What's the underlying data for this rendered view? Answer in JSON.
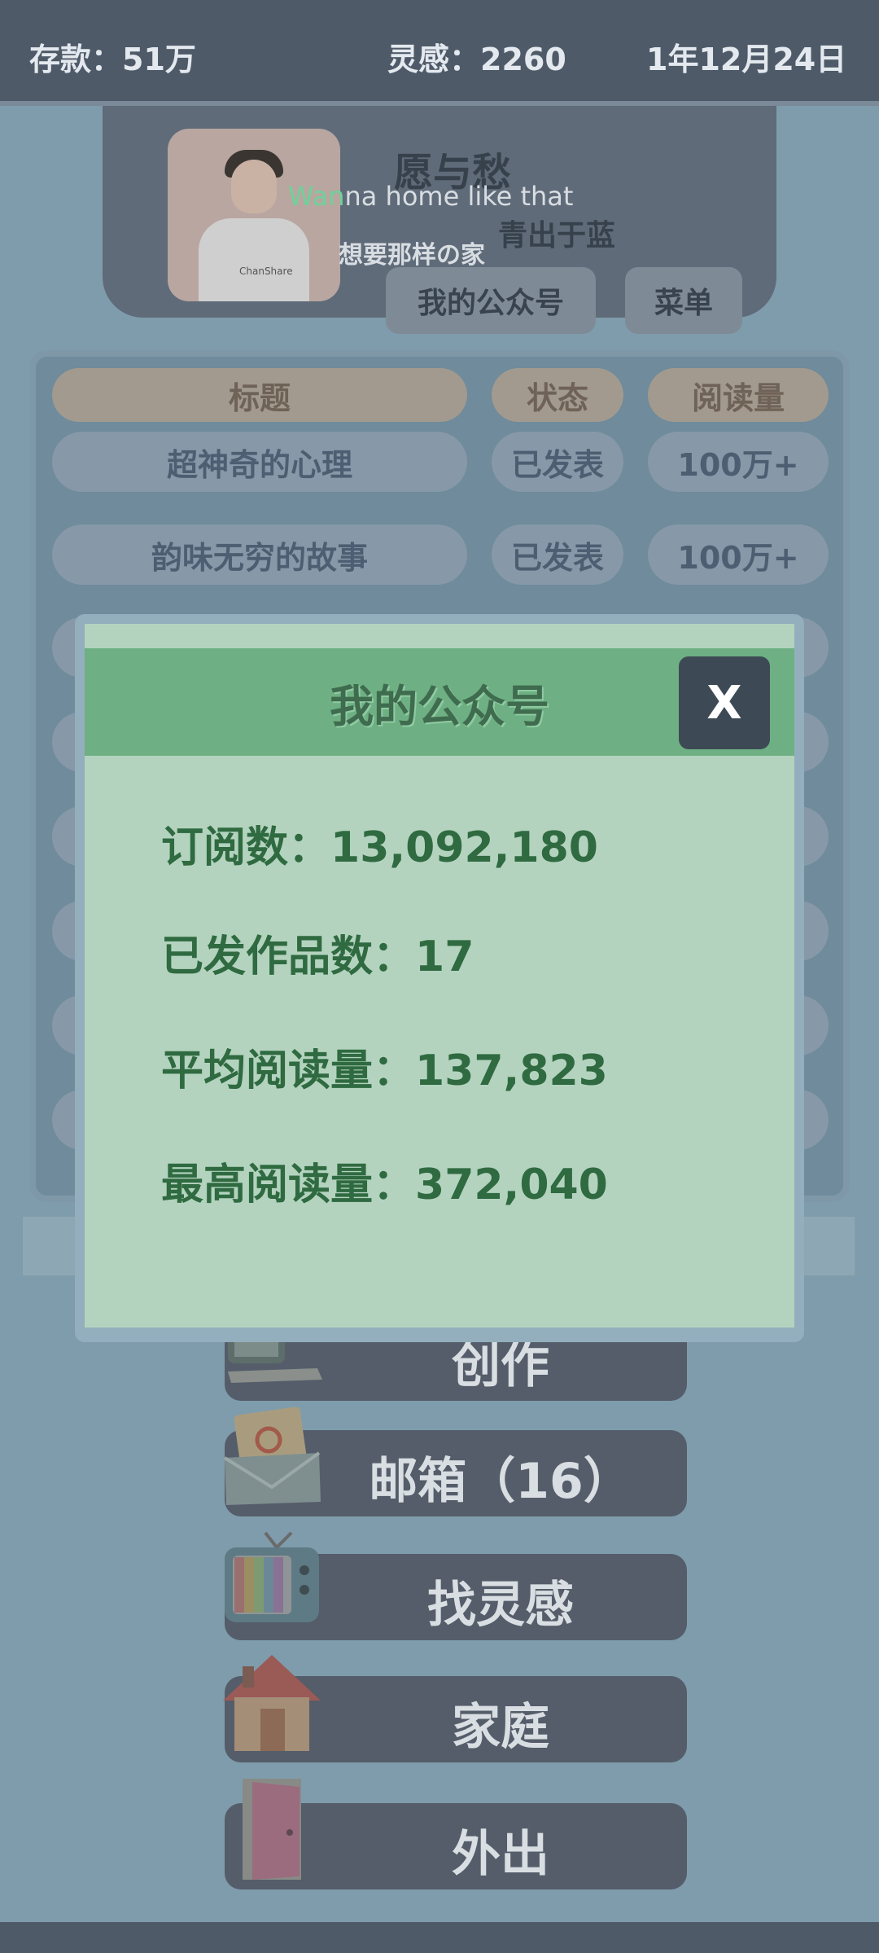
{
  "topbar": {
    "money": "存款：51万",
    "inspiration": "灵感：2260",
    "date": "1年12月24日"
  },
  "profile": {
    "name": "愿与愁",
    "tagline_en_prefix": "Wan",
    "tagline_en_rest": "na home like that",
    "tagline_cn": "想要那样の家",
    "signature": "青出于蓝",
    "shirt_text": "ChanShare",
    "official_account_button": "我的公众号",
    "menu_button": "菜单"
  },
  "table": {
    "headers": [
      "标题",
      "状态",
      "阅读量"
    ],
    "rows": [
      {
        "title": "超神奇的心理",
        "status": "已发表",
        "reads": "100万+"
      },
      {
        "title": "韵味无穷的故事",
        "status": "已发表",
        "reads": "100万+"
      }
    ]
  },
  "menu": {
    "create": "创作",
    "mailbox": "邮箱（16）",
    "find_inspiration": "找灵感",
    "family": "家庭",
    "go_out": "外出"
  },
  "modal": {
    "title": "我的公众号",
    "close": "X",
    "subscribers_label": "订阅数：",
    "subscribers": "13,092,180",
    "published_label": "已发作品数：",
    "published": "17",
    "avg_reads_label": "平均阅读量：",
    "avg_reads": "137,823",
    "max_reads_label": "最高阅读量：",
    "max_reads": "372,040"
  },
  "colors": {
    "modal_bg": "#b3d3bf",
    "modal_header": "#6eb083",
    "stat_text": "#2f6a40",
    "close_bg": "#3d4a55"
  }
}
